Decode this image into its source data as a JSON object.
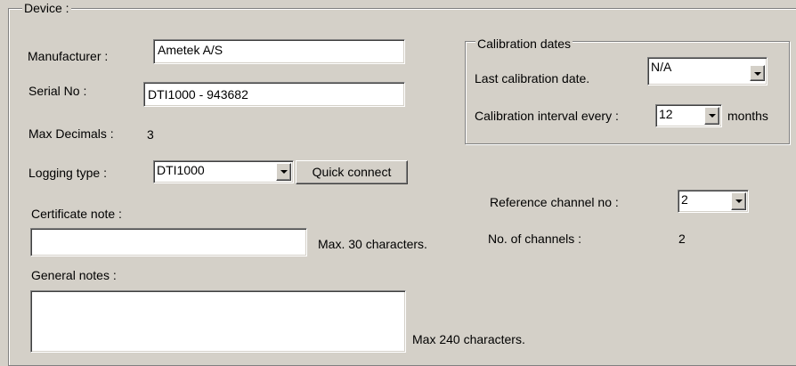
{
  "device_group": {
    "legend": "Device :",
    "manufacturer_label": "Manufacturer :",
    "manufacturer_value": "Ametek A/S",
    "serial_label": "Serial No :",
    "serial_value": "DTI1000 - 943682",
    "max_decimals_label": "Max Decimals :",
    "max_decimals_value": "3",
    "logging_type_label": "Logging type :",
    "logging_type_value": "DTI1000",
    "quick_connect_label": "Quick connect",
    "certificate_note_label": "Certificate note :",
    "certificate_note_value": "",
    "certificate_max_hint": "Max. 30 characters.",
    "general_notes_label": "General notes :",
    "general_notes_value": "",
    "general_max_hint": "Max 240 characters."
  },
  "calibration_group": {
    "legend": "Calibration dates",
    "last_date_label": "Last calibration date.",
    "last_date_value": "N/A",
    "interval_label": "Calibration interval every :",
    "interval_value": "12",
    "interval_unit": "months"
  },
  "channels": {
    "reference_label": "Reference channel no :",
    "reference_value": "2",
    "count_label": "No. of channels :",
    "count_value": "2"
  }
}
